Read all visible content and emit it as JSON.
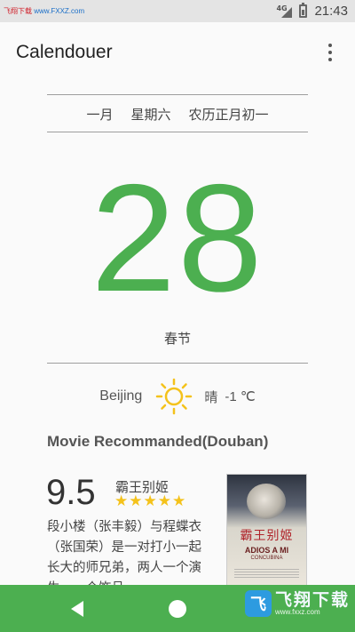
{
  "statusbar": {
    "watermark_text": "飞翔下载",
    "watermark_url": "www.FXXZ.com",
    "network": "4G",
    "time": "21:43"
  },
  "appbar": {
    "title": "Calendouer",
    "menu_icon": "more-vert-icon"
  },
  "date": {
    "month": "一月",
    "weekday": "星期六",
    "lunar": "农历正月初一",
    "day": "28",
    "festival": "春节"
  },
  "weather": {
    "city": "Beijing",
    "icon": "sun-icon",
    "condition": "晴",
    "temperature": "-1 ℃"
  },
  "movie_section": {
    "title": "Movie Recommanded(Douban)",
    "rating": "9.5",
    "name": "霸王别姬",
    "stars": 5,
    "synopsis": "段小楼（张丰毅）与程蝶衣（张国荣）是一对打小一起长大的师兄弟，两人一个演生，一个饰旦，一",
    "poster": {
      "title_cn": "霸王别姬",
      "title_en": "ADIOS A MI",
      "title_en2": "CONCUBINA"
    }
  },
  "navbar": {
    "back_icon": "back-triangle-icon",
    "home_icon": "home-circle-icon",
    "watermark_logo": "飞",
    "watermark_cn": "飞翔下载",
    "watermark_url": "www.fxxz.com"
  },
  "colors": {
    "accent": "#4caf50",
    "star": "#f4c21b",
    "sun": "#f4c21b"
  }
}
